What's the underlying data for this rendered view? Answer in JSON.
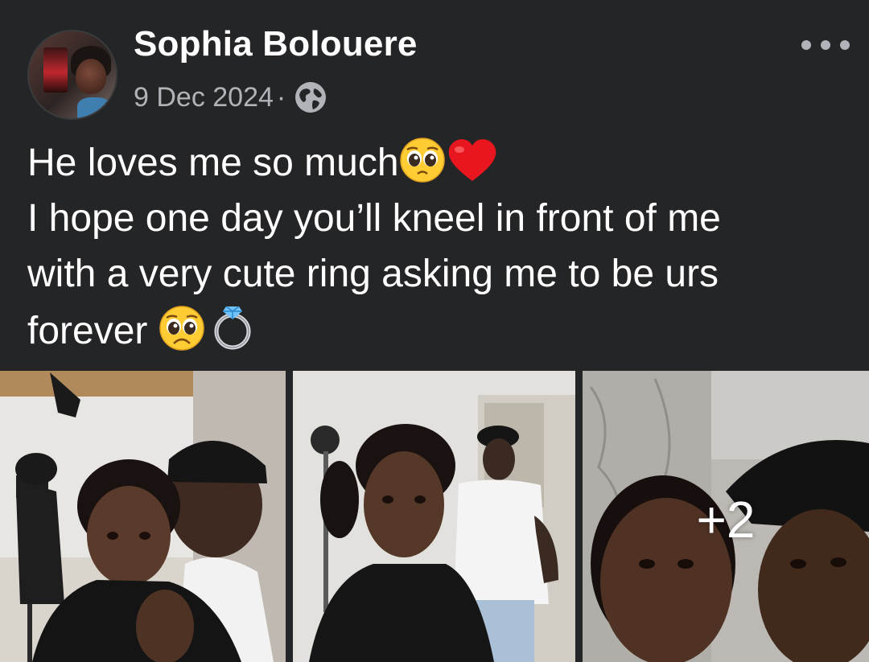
{
  "post": {
    "author": "Sophia Bolouere",
    "date": "9 Dec 2024",
    "separator": "·",
    "privacy_icon": "globe-icon",
    "more_icon": "more-horizontal-icon",
    "text_lines": [
      "He loves me so much",
      "I hope one day you’ll kneel in front of me",
      "with a very cute ring asking me to be urs",
      "forever "
    ],
    "emojis": {
      "line1": [
        "pleading-face-emoji",
        "red-heart-emoji"
      ],
      "line4": [
        "pleading-face-emoji",
        "ring-emoji"
      ]
    }
  },
  "gallery": {
    "photo_count_visible": 3,
    "more_photos_label": "+2"
  },
  "colors": {
    "background": "#242526",
    "primary_text": "#ffffff",
    "secondary_text": "#b0b3b8"
  }
}
